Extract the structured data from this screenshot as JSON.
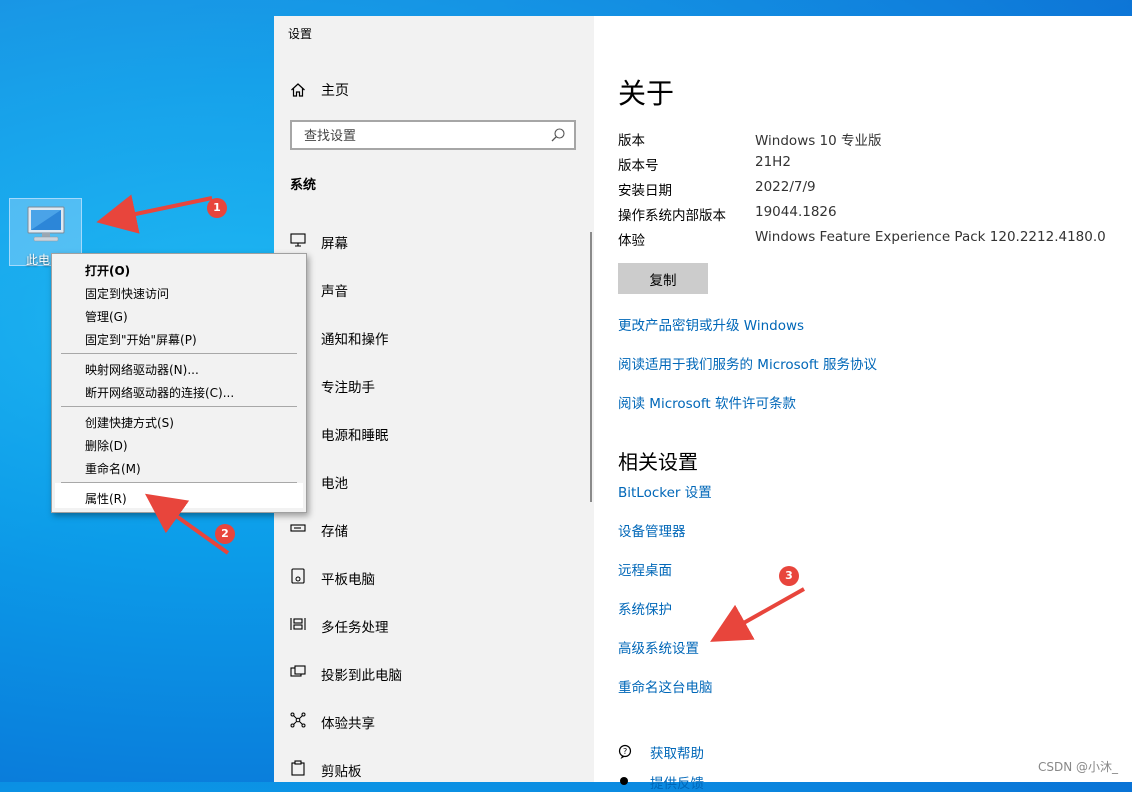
{
  "desktop": {
    "icon_label": "此电"
  },
  "settings": {
    "window_title": "设置",
    "home_label": "主页",
    "search_placeholder": "查找设置",
    "section_title": "系统",
    "nav_items": [
      {
        "label": "屏幕",
        "icon": "monitor-icon"
      },
      {
        "label": "声音",
        "icon": "speaker-icon"
      },
      {
        "label": "通知和操作",
        "icon": "notification-icon"
      },
      {
        "label": "专注助手",
        "icon": "moon-icon"
      },
      {
        "label": "电源和睡眠",
        "icon": "power-icon"
      },
      {
        "label": "电池",
        "icon": "battery-icon"
      },
      {
        "label": "存储",
        "icon": "storage-icon"
      },
      {
        "label": "平板电脑",
        "icon": "tablet-icon"
      },
      {
        "label": "多任务处理",
        "icon": "multitask-icon"
      },
      {
        "label": "投影到此电脑",
        "icon": "project-icon"
      },
      {
        "label": "体验共享",
        "icon": "share-icon"
      },
      {
        "label": "剪贴板",
        "icon": "clipboard-icon"
      }
    ],
    "about": {
      "title": "关于",
      "specs": [
        {
          "key": "版本",
          "value": "Windows 10 专业版"
        },
        {
          "key": "版本号",
          "value": "21H2"
        },
        {
          "key": "安装日期",
          "value": "2022/7/9"
        },
        {
          "key": "操作系统内部版本",
          "value": "19044.1826"
        },
        {
          "key": "体验",
          "value": "Windows Feature Experience Pack 120.2212.4180.0"
        }
      ],
      "copy_label": "复制",
      "links": [
        "更改产品密钥或升级 Windows",
        "阅读适用于我们服务的 Microsoft 服务协议",
        "阅读 Microsoft 软件许可条款"
      ]
    },
    "related": {
      "title": "相关设置",
      "links": [
        "BitLocker 设置",
        "设备管理器",
        "远程桌面",
        "系统保护",
        "高级系统设置",
        "重命名这台电脑"
      ]
    },
    "help": {
      "get_help": "获取帮助",
      "feedback": "提供反馈"
    }
  },
  "context_menu": {
    "items": [
      "打开(O)",
      "固定到快速访问",
      "管理(G)",
      "固定到\"开始\"屏幕(P)",
      "映射网络驱动器(N)...",
      "断开网络驱动器的连接(C)...",
      "创建快捷方式(S)",
      "删除(D)",
      "重命名(M)",
      "属性(R)"
    ]
  },
  "annotations": {
    "badges": [
      "1",
      "2",
      "3"
    ],
    "arrow_color": "#e8453c"
  },
  "watermark": "CSDN @小沐_",
  "colors": {
    "link": "#0067b8",
    "nav_bg": "#f2f2f2",
    "desktop": "#0a8fe4"
  }
}
